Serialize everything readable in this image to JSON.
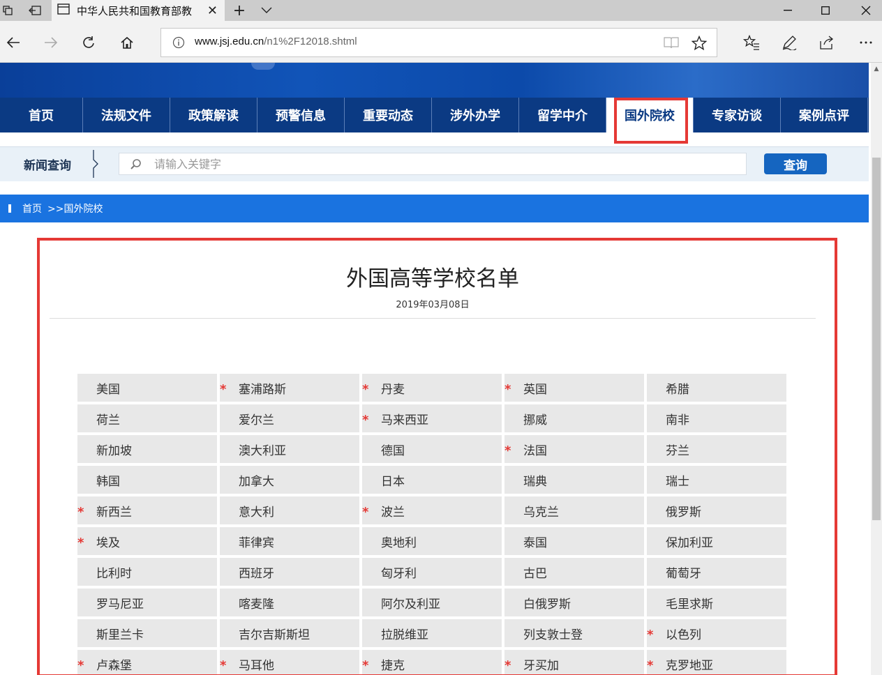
{
  "browser": {
    "tab_title": "中华人民共和国教育部教",
    "url_host": "www.jsj.edu.cn",
    "url_path": "/n1%2F12018.shtml"
  },
  "nav": {
    "items": [
      "首页",
      "法规文件",
      "政策解读",
      "预警信息",
      "重要动态",
      "涉外办学",
      "留学中介",
      "国外院校",
      "专家访谈",
      "案例点评"
    ],
    "active_index": 7
  },
  "search": {
    "label": "新闻查询",
    "placeholder": "请输入关键字",
    "button": "查询"
  },
  "breadcrumb": {
    "home": "首页",
    "current": ">>国外院校"
  },
  "article": {
    "title": "外国高等学校名单",
    "date": "2019年03月08日"
  },
  "star_symbol": "*",
  "countries": [
    [
      {
        "name": "美国",
        "star": false
      },
      {
        "name": "塞浦路斯",
        "star": true
      },
      {
        "name": "丹麦",
        "star": true
      },
      {
        "name": "英国",
        "star": true
      },
      {
        "name": "希腊",
        "star": false
      }
    ],
    [
      {
        "name": "荷兰",
        "star": false
      },
      {
        "name": "爱尔兰",
        "star": false
      },
      {
        "name": "马来西亚",
        "star": true
      },
      {
        "name": "挪威",
        "star": false
      },
      {
        "name": "南非",
        "star": false
      }
    ],
    [
      {
        "name": "新加坡",
        "star": false
      },
      {
        "name": "澳大利亚",
        "star": false
      },
      {
        "name": "德国",
        "star": false
      },
      {
        "name": "法国",
        "star": true
      },
      {
        "name": "芬兰",
        "star": false
      }
    ],
    [
      {
        "name": "韩国",
        "star": false
      },
      {
        "name": "加拿大",
        "star": false
      },
      {
        "name": "日本",
        "star": false
      },
      {
        "name": "瑞典",
        "star": false
      },
      {
        "name": "瑞士",
        "star": false
      }
    ],
    [
      {
        "name": "新西兰",
        "star": true
      },
      {
        "name": "意大利",
        "star": false
      },
      {
        "name": "波兰",
        "star": true
      },
      {
        "name": "乌克兰",
        "star": false
      },
      {
        "name": "俄罗斯",
        "star": false
      }
    ],
    [
      {
        "name": "埃及",
        "star": true
      },
      {
        "name": "菲律宾",
        "star": false
      },
      {
        "name": "奥地利",
        "star": false
      },
      {
        "name": "泰国",
        "star": false
      },
      {
        "name": "保加利亚",
        "star": false
      }
    ],
    [
      {
        "name": "比利时",
        "star": false
      },
      {
        "name": "西班牙",
        "star": false
      },
      {
        "name": "匈牙利",
        "star": false
      },
      {
        "name": "古巴",
        "star": false
      },
      {
        "name": "葡萄牙",
        "star": false
      }
    ],
    [
      {
        "name": "罗马尼亚",
        "star": false
      },
      {
        "name": "喀麦隆",
        "star": false
      },
      {
        "name": "阿尔及利亚",
        "star": false
      },
      {
        "name": "白俄罗斯",
        "star": false
      },
      {
        "name": "毛里求斯",
        "star": false
      }
    ],
    [
      {
        "name": "斯里兰卡",
        "star": false
      },
      {
        "name": "吉尔吉斯斯坦",
        "star": false
      },
      {
        "name": "拉脱维亚",
        "star": false
      },
      {
        "name": "列支敦士登",
        "star": false
      },
      {
        "name": "以色列",
        "star": true
      }
    ],
    [
      {
        "name": "卢森堡",
        "star": true
      },
      {
        "name": "马耳他",
        "star": true
      },
      {
        "name": "捷克",
        "star": true
      },
      {
        "name": "牙买加",
        "star": true
      },
      {
        "name": "克罗地亚",
        "star": true
      }
    ]
  ],
  "colors": {
    "nav_bg": "#0b3a83",
    "breadcrumb_bg": "#1a73e0",
    "highlight": "#e53935",
    "search_button": "#1565c0"
  }
}
